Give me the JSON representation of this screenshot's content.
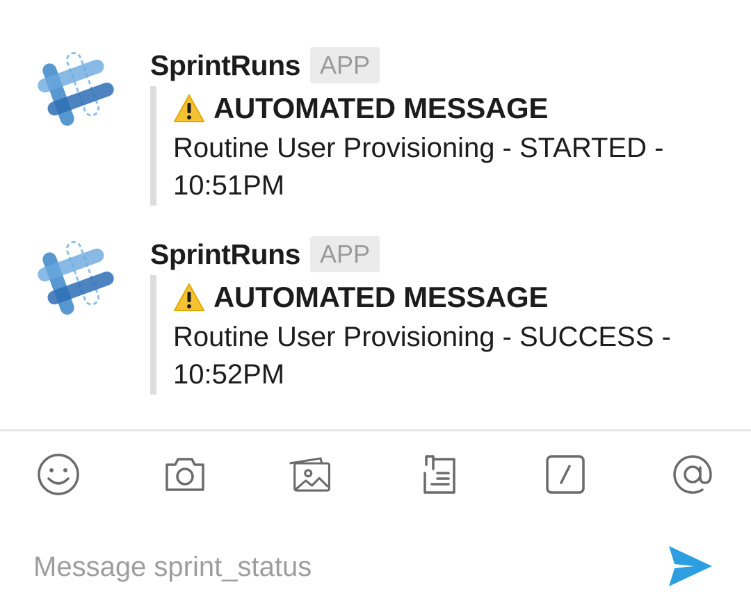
{
  "messages": [
    {
      "sender": "SprintRuns",
      "badge": "APP",
      "title": "AUTOMATED MESSAGE",
      "body": " Routine User Provisioning - STARTED - 10:51PM",
      "avatar_icon": "hash-logo-icon",
      "title_icon": "warning-icon"
    },
    {
      "sender": "SprintRuns",
      "badge": "APP",
      "title": "AUTOMATED MESSAGE",
      "body": " Routine User Provisioning - SUCCESS - 10:52PM",
      "avatar_icon": "hash-logo-icon",
      "title_icon": "warning-icon"
    }
  ],
  "toolbar": {
    "icons": [
      "emoji-icon",
      "camera-icon",
      "photo-gallery-icon",
      "file-attach-icon",
      "slash-command-icon",
      "mention-icon"
    ]
  },
  "composer": {
    "placeholder": "Message sprint_status",
    "value": "",
    "send_icon": "send-icon"
  },
  "colors": {
    "accent": "#2d9ee0",
    "avatar_blue": "#3a86c8",
    "icon_gray": "#6b6b6b",
    "badge_bg": "#ebebeb",
    "attachment_border": "#dddddd"
  }
}
